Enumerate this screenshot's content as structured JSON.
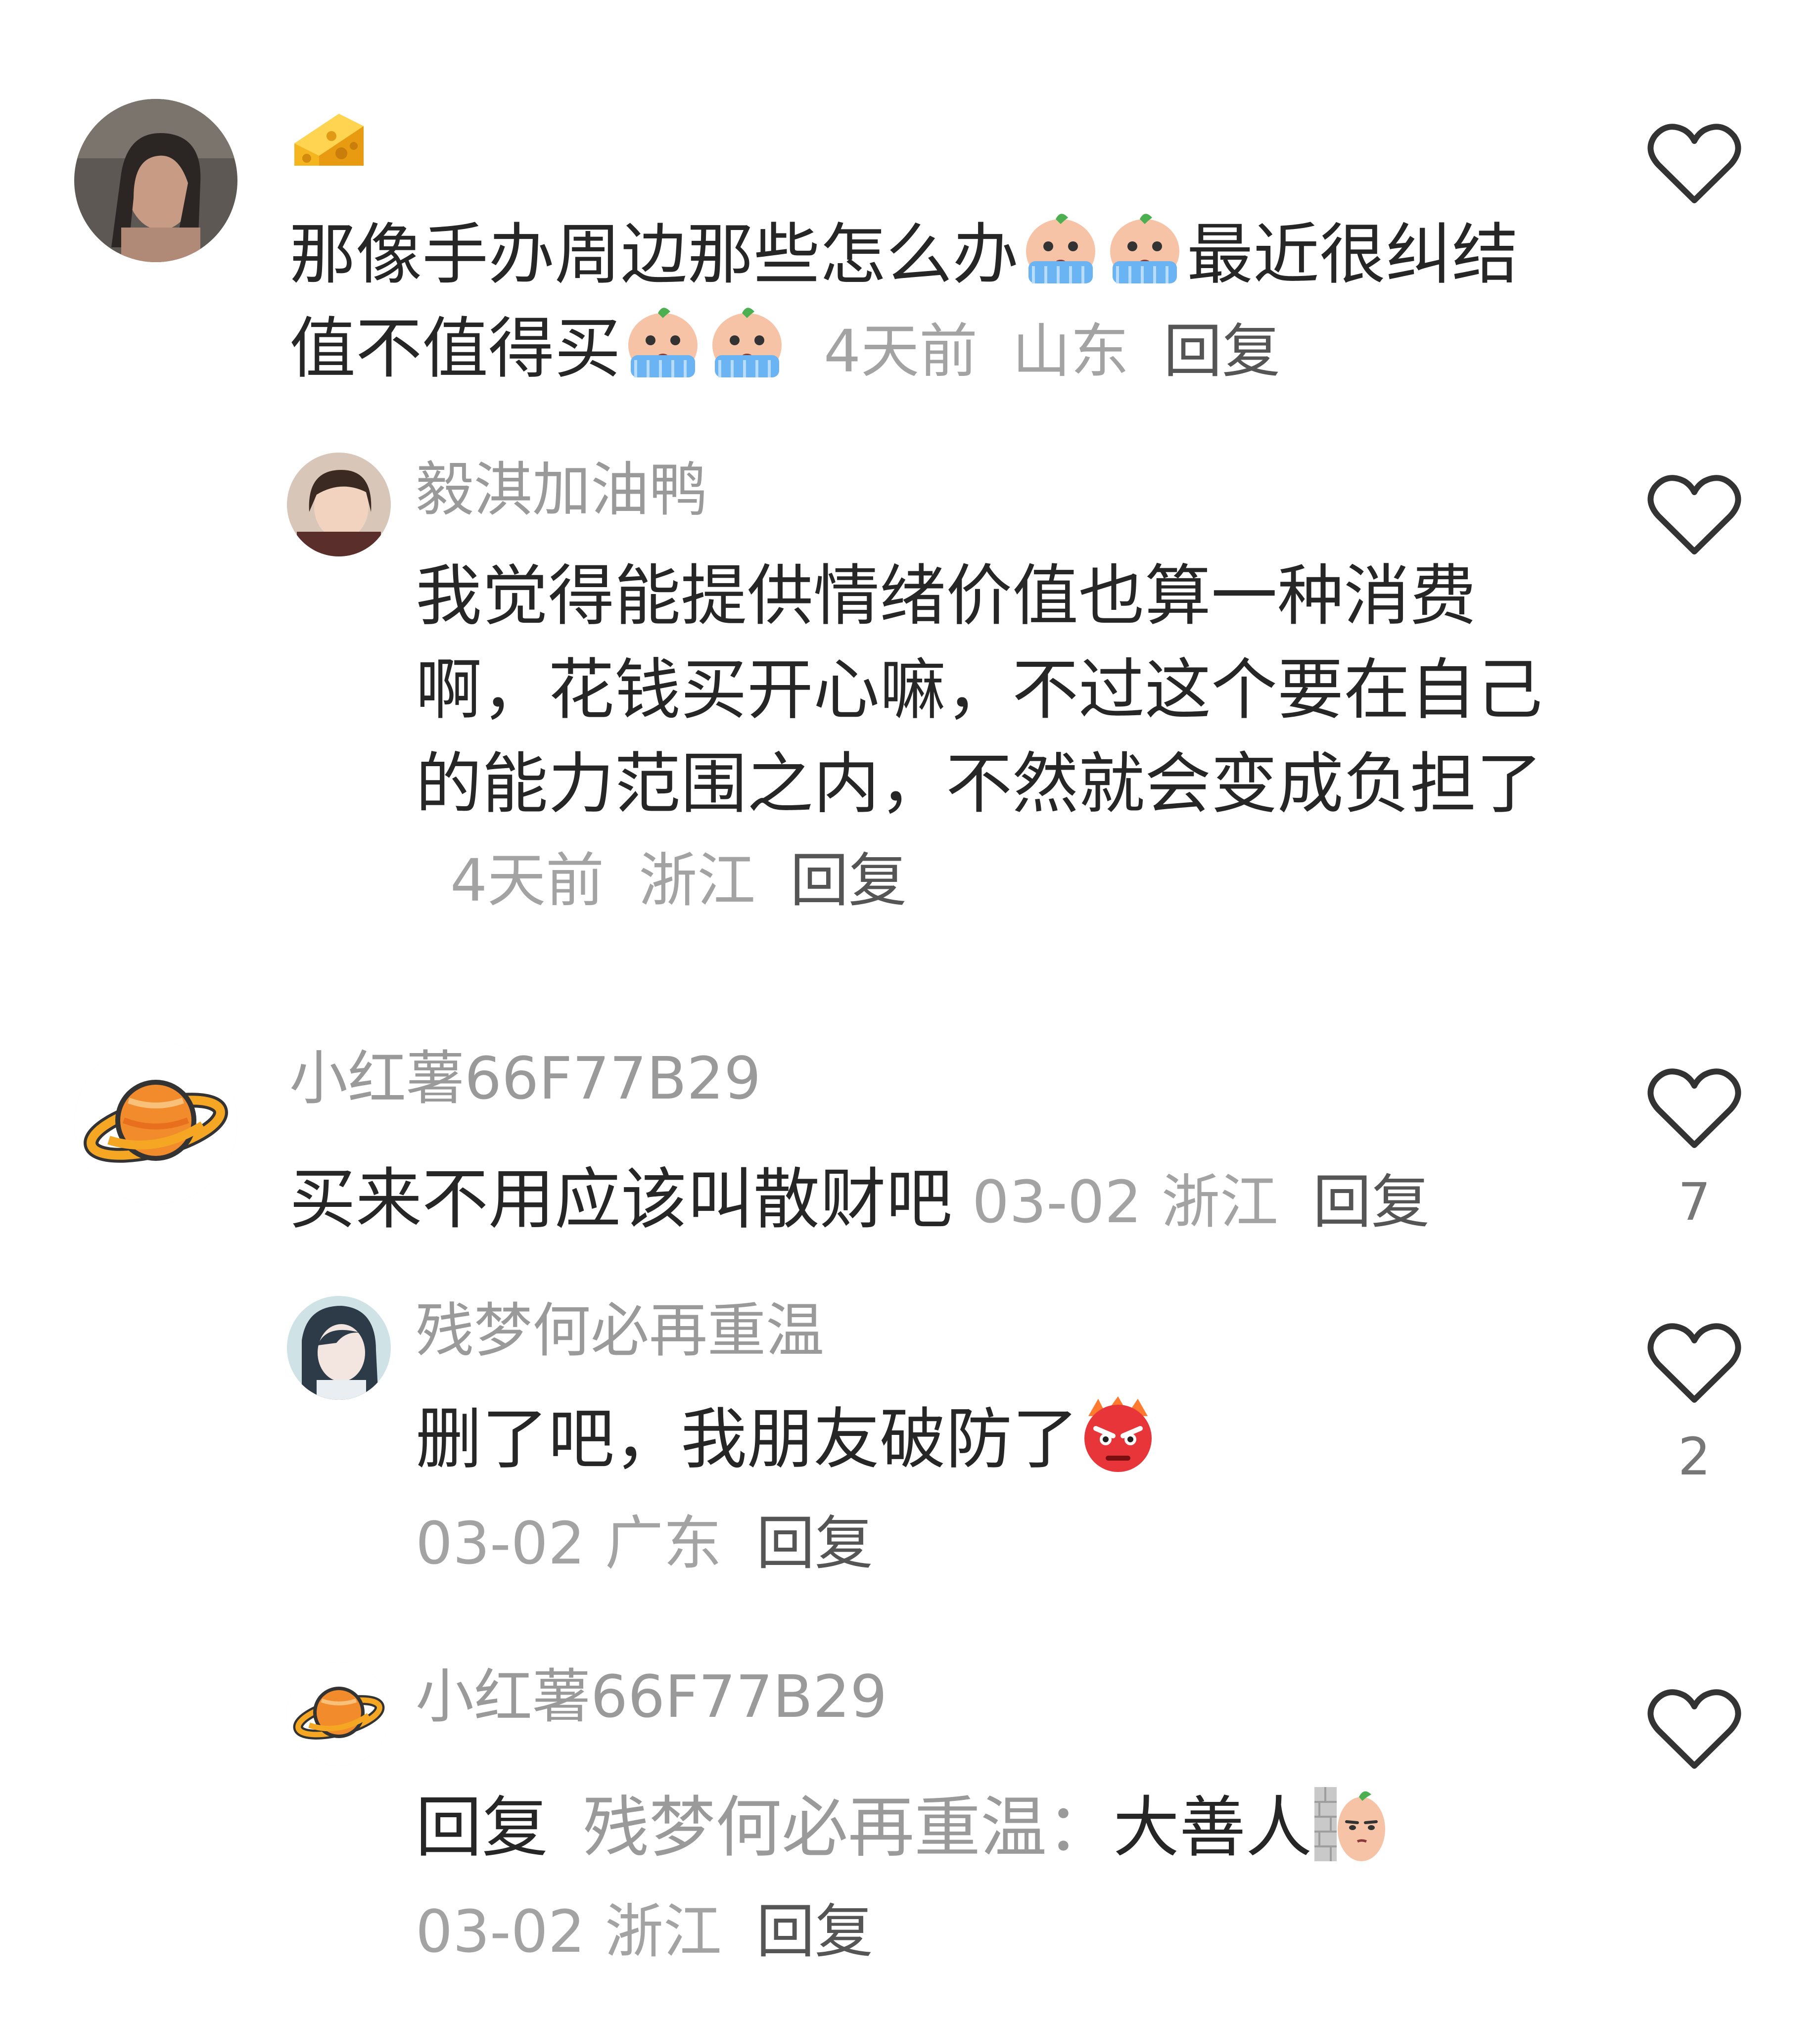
{
  "comments": [
    {
      "name_badge": "cheese-emoji",
      "text_a": "那像手办周边那些怎么办",
      "text_b": "最近很纠结值不值得买",
      "time": "4天前",
      "location": "山东",
      "reply_label": "回复",
      "like_count": "",
      "replies": [
        {
          "name": "毅淇加油鸭",
          "text": "我觉得能提供情绪价值也算一种消费啊，花钱买开心嘛，不过这个要在自己的能力范围之内，不然就会变成负担了",
          "time": "4天前",
          "location": "浙江",
          "reply_label": "回复",
          "like_count": ""
        }
      ]
    },
    {
      "name": "小红薯66F77B29",
      "text": "买来不用应该叫散财吧",
      "time": "03-02",
      "location": "浙江",
      "reply_label": "回复",
      "like_count": "7",
      "replies": [
        {
          "name": "残梦何必再重温",
          "text": "删了吧，我朋友破防了",
          "time": "03-02",
          "location": "广东",
          "reply_label": "回复",
          "like_count": "2"
        },
        {
          "name": "小红薯66F77B29",
          "reply_prefix": "回复",
          "mention": "残梦何必再重温：",
          "text": "大善人",
          "time": "03-02",
          "location": "浙江",
          "reply_label": "回复",
          "like_count": ""
        }
      ]
    }
  ],
  "colors": {
    "name_gray": "#9a9a9a",
    "text_dark": "#262626",
    "meta_gray": "#a3a3a3",
    "reply_link": "#555555",
    "heart_stroke": "#333333"
  }
}
